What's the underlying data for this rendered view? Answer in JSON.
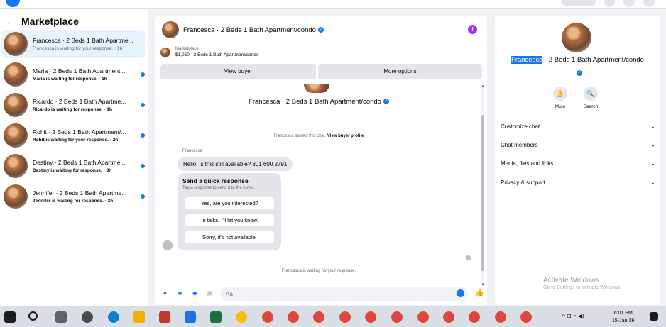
{
  "left": {
    "title": "Marketplace",
    "conversations": [
      {
        "name": "Francesca · 2 Beds 1 Bath Apartme...",
        "sub": "Francesca is waiting for your response. · 1h",
        "unread": false
      },
      {
        "name": "Maria · 2 Beds 1 Bath Apartment...",
        "sub": "Maria is waiting for response. · 1h",
        "unread": true
      },
      {
        "name": "Ricardo · 2 Beds 1 Bath Apartme...",
        "sub": "Ricardo is waiting for response. · 1h",
        "unread": true
      },
      {
        "name": "Rohit · 2 Beds 1 Bath Apartment/...",
        "sub": "Rohit is waiting for your response. · 2h",
        "unread": true
      },
      {
        "name": "Destiny · 2 Beds 1 Bath Apartme...",
        "sub": "Destiny is waiting for response. · 3h",
        "unread": true
      },
      {
        "name": "Jennifer · 2 Beds 1 Bath Apartme...",
        "sub": "Jennifer is waiting for response. · 3h",
        "unread": true
      }
    ]
  },
  "chat": {
    "header_title": "Francesca · 2 Beds 1 Bath Apartment/condo",
    "marketplace_label": "Marketplace",
    "listing": "$1,050 - 2 Beds 1 Bath Apartment/condo",
    "view_buyer": "View buyer",
    "more_options": "More options",
    "convo_title": "Francesca · 2 Beds 1 Bath Apartment/condo",
    "started_text": "Francesca started this chat.",
    "view_profile": "View buyer profile",
    "sender": "Francesca",
    "message": "Hello, is this still available? 801 600 2791",
    "quick_title": "Send a quick response",
    "quick_sub": "Tap a response to send it to the buyer.",
    "quick_replies": [
      "Yes, are you interested?",
      "In talks. I'll let you know.",
      "Sorry, it's not available."
    ],
    "waiting": "Francesca is waiting for your response.",
    "input_placeholder": "Aa"
  },
  "right": {
    "title_highlight": "Francesca",
    "title_rest": "· 2 Beds 1 Bath Apartment/condo",
    "actions": [
      "Mute",
      "Search"
    ],
    "rows": [
      "Customize chat",
      "Chat members",
      "Media, files and links",
      "Privacy & support"
    ],
    "watermark_1": "Activate Windows",
    "watermark_2": "Go to Settings to activate Windows."
  },
  "taskbar": {
    "time": "6:01 PM",
    "date": "15-Jan-26"
  },
  "colors": {
    "accent": "#1877f2",
    "selection": "#1a73e8",
    "info": "#a033ff"
  }
}
